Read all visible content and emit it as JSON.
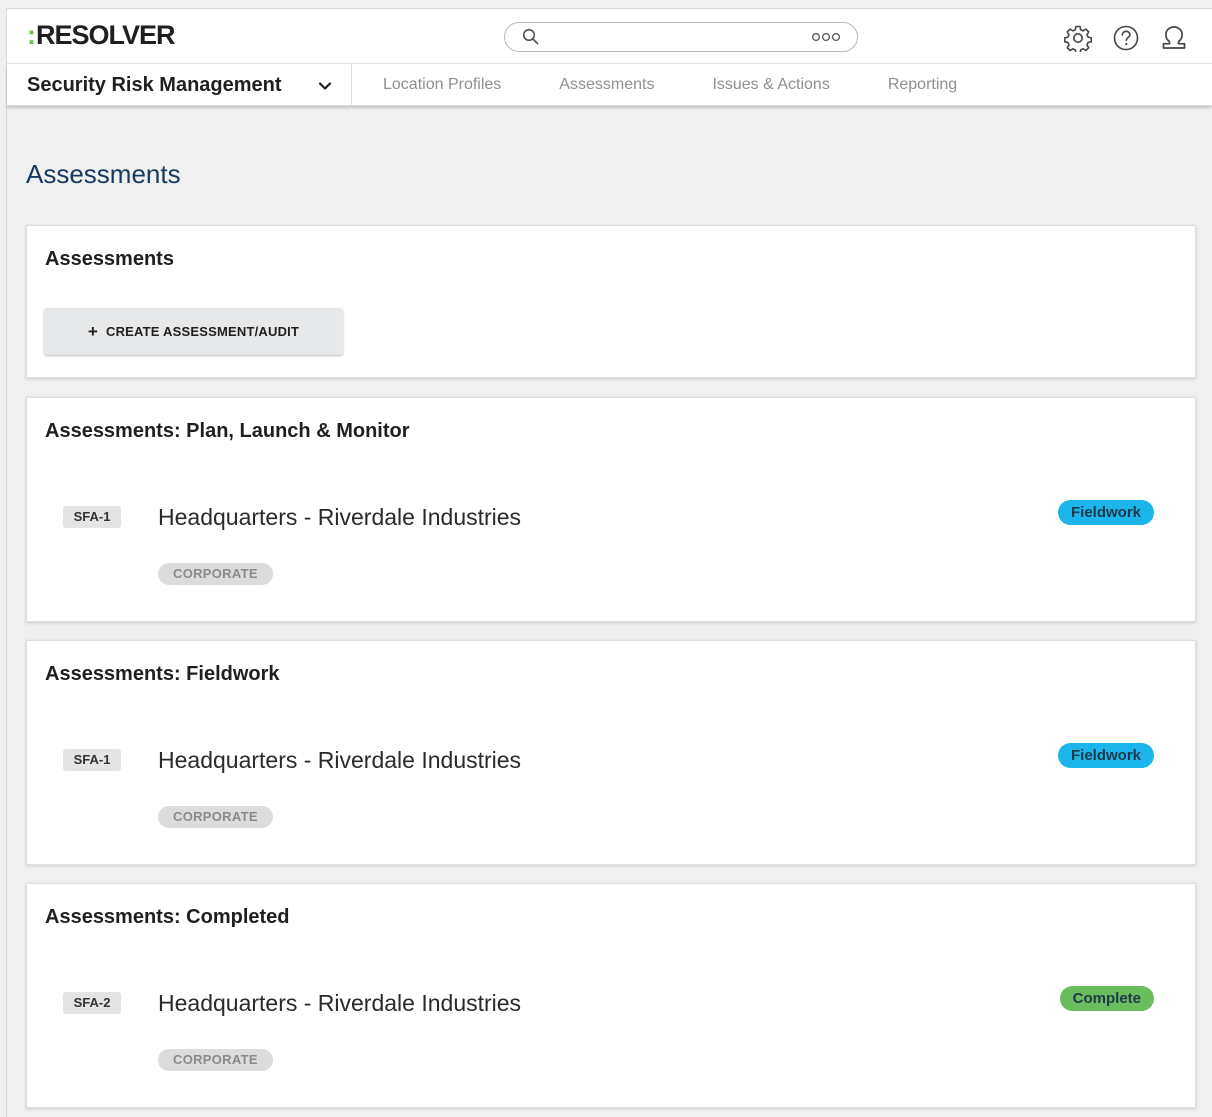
{
  "header": {
    "logo_prefix": ":",
    "logo_text": "RESOLVER",
    "search": {
      "placeholder": "",
      "value": ""
    },
    "icons": [
      "gear-icon",
      "help-icon",
      "user-icon"
    ]
  },
  "nav": {
    "app_name": "Security Risk Management",
    "tabs": [
      "Location Profiles",
      "Assessments",
      "Issues & Actions",
      "Reporting"
    ]
  },
  "page": {
    "title": "Assessments"
  },
  "cards": {
    "create": {
      "title": "Assessments",
      "button_label": "CREATE ASSESSMENT/AUDIT"
    },
    "plan": {
      "title": "Assessments: Plan, Launch & Monitor",
      "item": {
        "id": "SFA-1",
        "name": "Headquarters - Riverdale Industries",
        "tag": "CORPORATE",
        "status": "Fieldwork"
      }
    },
    "fieldwork": {
      "title": "Assessments: Fieldwork",
      "item": {
        "id": "SFA-1",
        "name": "Headquarters - Riverdale Industries",
        "tag": "CORPORATE",
        "status": "Fieldwork"
      }
    },
    "completed": {
      "title": "Assessments: Completed",
      "item": {
        "id": "SFA-2",
        "name": "Headquarters - Riverdale Industries",
        "tag": "CORPORATE",
        "status": "Complete"
      }
    }
  },
  "colors": {
    "brand_green": "#6ac046",
    "title_blue": "#17395f",
    "status_fieldwork": "#1bb5ec",
    "status_complete": "#69bd5c"
  }
}
